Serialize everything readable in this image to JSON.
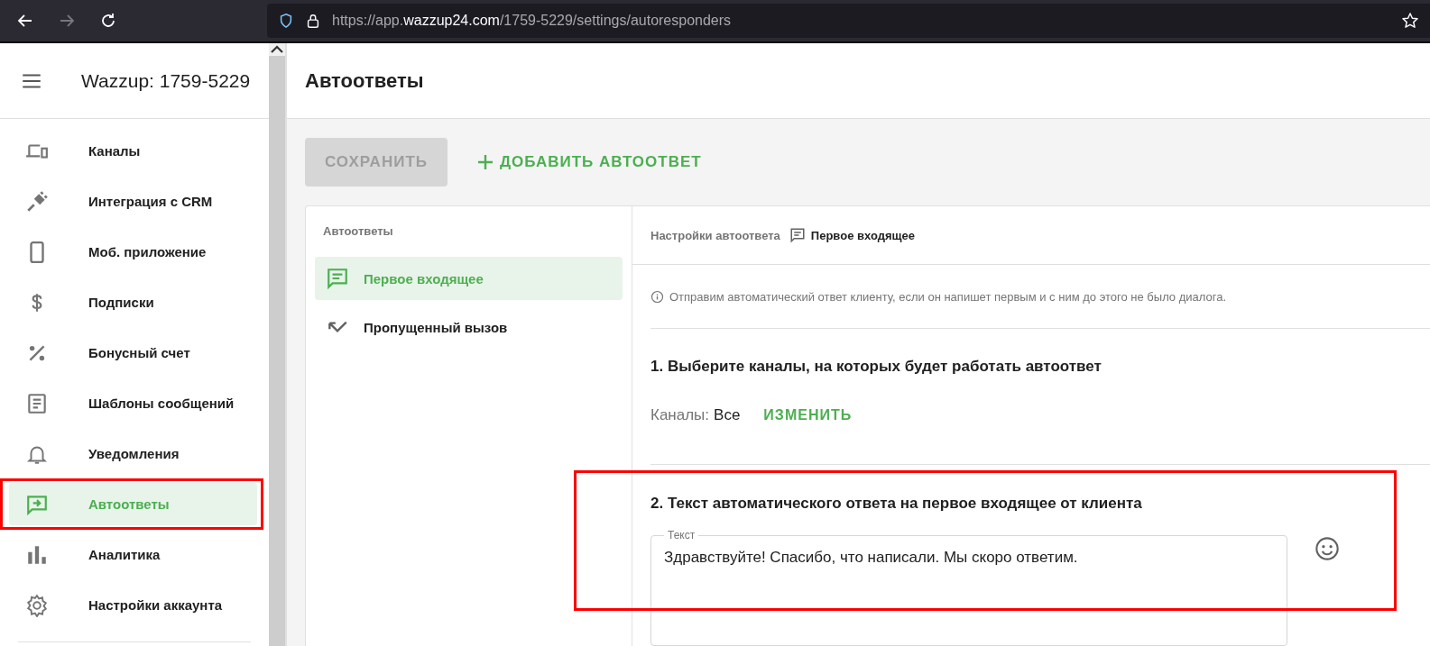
{
  "browser": {
    "url": {
      "prefix": "https://app.",
      "domain": "wazzup24.com",
      "path": "/1759-5229/settings/autoresponders"
    }
  },
  "sidebar": {
    "title": "Wazzup: 1759-5229",
    "items": [
      {
        "label": "Каналы",
        "kind": "devices",
        "selected": false,
        "highlighted": false
      },
      {
        "label": "Интеграция с CRM",
        "kind": "plug",
        "selected": false,
        "highlighted": false
      },
      {
        "label": "Моб. приложение",
        "kind": "phone",
        "selected": false,
        "highlighted": false
      },
      {
        "label": "Подписки",
        "kind": "dollar",
        "selected": false,
        "highlighted": false
      },
      {
        "label": "Бонусный счет",
        "kind": "percent",
        "selected": false,
        "highlighted": false
      },
      {
        "label": "Шаблоны сообщений",
        "kind": "doc",
        "selected": false,
        "highlighted": false
      },
      {
        "label": "Уведомления",
        "kind": "bell",
        "selected": false,
        "highlighted": false
      },
      {
        "label": "Автоответы",
        "kind": "reply",
        "selected": true,
        "highlighted": true
      },
      {
        "label": "Аналитика",
        "kind": "chart",
        "selected": false,
        "highlighted": false
      },
      {
        "label": "Настройки аккаунта",
        "kind": "gear",
        "selected": false,
        "highlighted": false
      }
    ]
  },
  "page": {
    "title": "Автоответы",
    "save_button": {
      "label": "СОХРАНИТЬ",
      "disabled": true
    },
    "add_button": {
      "label": "ДОБАВИТЬ АВТООТВЕТ"
    },
    "list": {
      "title": "Автоответы",
      "items": [
        {
          "label": "Первое входящее",
          "kind": "message",
          "selected": true
        },
        {
          "label": "Пропущенный вызов",
          "kind": "missed",
          "selected": false
        }
      ]
    },
    "settings": {
      "breadcrumb": "Настройки автоответа",
      "current": "Первое входящее",
      "info": "Отправим автоматический ответ клиенту, если он напишет первым и с ним до этого не было диалога.",
      "section1": {
        "title": "1. Выберите каналы, на которых будет работать автоответ",
        "channels_label": "Каналы:",
        "channels_value": "Все",
        "change_link": "ИЗМЕНИТЬ"
      },
      "section2": {
        "title": "2. Текст автоматического ответа на первое входящее от клиента",
        "highlighted": true,
        "field": {
          "label": "Текст",
          "value": "Здравствуйте! Спасибо, что написали. Мы скоро ответим."
        }
      }
    }
  }
}
